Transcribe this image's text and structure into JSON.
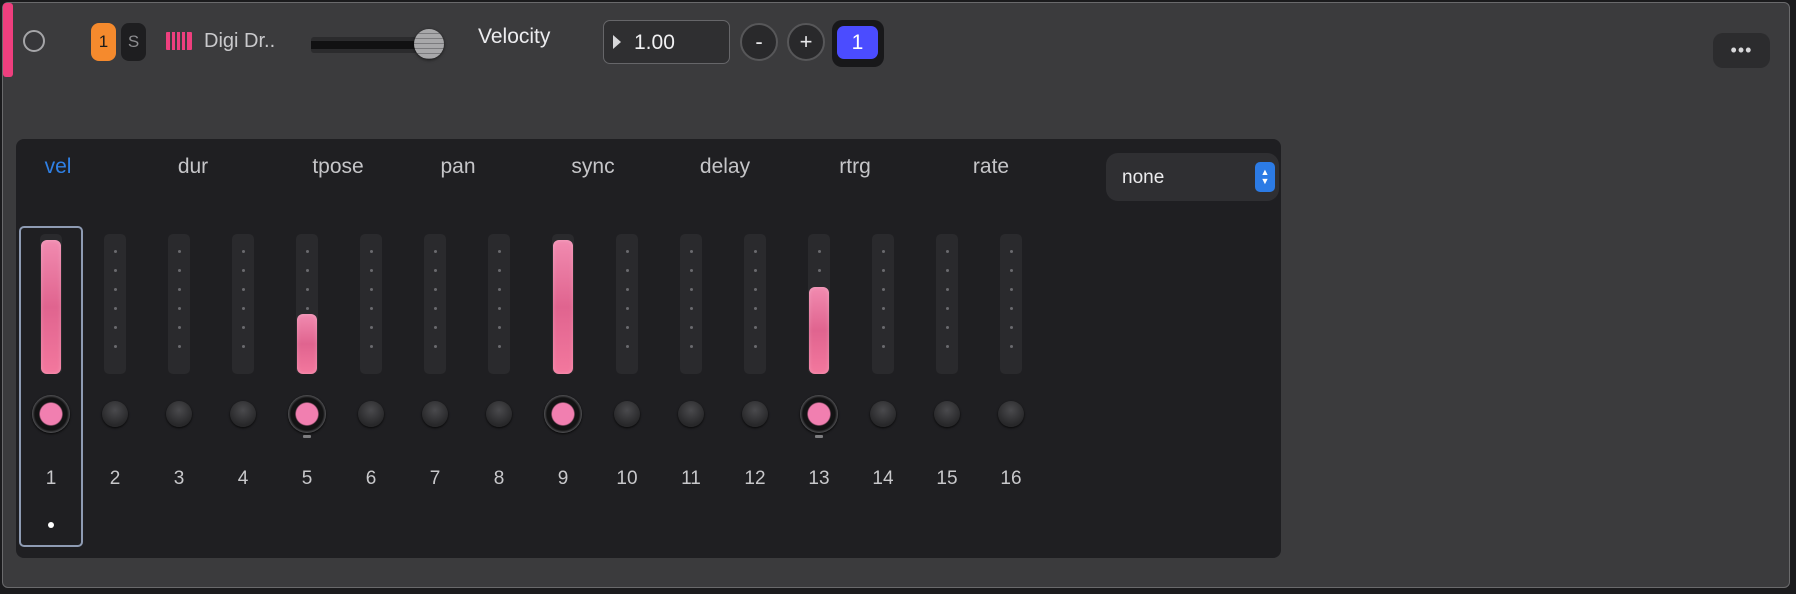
{
  "track": {
    "color": "#ee3f7e",
    "record_icon": "record-circle-icon",
    "channel_chip": "1",
    "solo_chip": "S",
    "instrument_icon": "piano-keys-icon",
    "instrument_name": "Digi Dr..",
    "volume_level": 0.87,
    "parameter_label": "Velocity",
    "value_field": "1.00",
    "minus_label": "-",
    "plus_label": "+",
    "step_button": "1",
    "more_label": "•••"
  },
  "sequencer": {
    "tabs": [
      "vel",
      "dur",
      "tpose",
      "pan",
      "sync",
      "delay",
      "rtrg",
      "rate"
    ],
    "active_tab": "vel",
    "mode_select": "none",
    "selected_step": 1,
    "playhead_step": 1,
    "steps": [
      {
        "num": "1",
        "on": true,
        "level": 0.96,
        "marker": false
      },
      {
        "num": "2",
        "on": false,
        "level": 0,
        "marker": false
      },
      {
        "num": "3",
        "on": false,
        "level": 0,
        "marker": false
      },
      {
        "num": "4",
        "on": false,
        "level": 0,
        "marker": false
      },
      {
        "num": "5",
        "on": true,
        "level": 0.43,
        "marker": true
      },
      {
        "num": "6",
        "on": false,
        "level": 0,
        "marker": false
      },
      {
        "num": "7",
        "on": false,
        "level": 0,
        "marker": false
      },
      {
        "num": "8",
        "on": false,
        "level": 0,
        "marker": false
      },
      {
        "num": "9",
        "on": true,
        "level": 0.96,
        "marker": false
      },
      {
        "num": "10",
        "on": false,
        "level": 0,
        "marker": false
      },
      {
        "num": "11",
        "on": false,
        "level": 0,
        "marker": false
      },
      {
        "num": "12",
        "on": false,
        "level": 0,
        "marker": false
      },
      {
        "num": "13",
        "on": true,
        "level": 0.62,
        "marker": true
      },
      {
        "num": "14",
        "on": false,
        "level": 0,
        "marker": false
      },
      {
        "num": "15",
        "on": false,
        "level": 0,
        "marker": false
      },
      {
        "num": "16",
        "on": false,
        "level": 0,
        "marker": false
      }
    ]
  }
}
